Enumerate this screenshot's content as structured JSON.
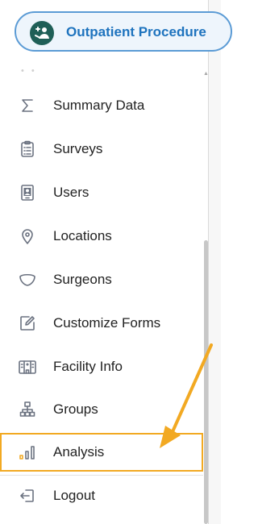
{
  "header": {
    "title": "Outpatient Procedure"
  },
  "menu": {
    "items": [
      {
        "label": "Summary Data",
        "icon": "sigma-icon"
      },
      {
        "label": "Surveys",
        "icon": "clipboard-icon"
      },
      {
        "label": "Users",
        "icon": "user-badge-icon"
      },
      {
        "label": "Locations",
        "icon": "map-pin-icon"
      },
      {
        "label": "Surgeons",
        "icon": "shield-icon"
      },
      {
        "label": "Customize Forms",
        "icon": "edit-form-icon"
      },
      {
        "label": "Facility Info",
        "icon": "building-icon"
      },
      {
        "label": "Groups",
        "icon": "hierarchy-icon"
      },
      {
        "label": "Analysis",
        "icon": "bar-chart-icon",
        "highlighted": true
      },
      {
        "label": "Logout",
        "icon": "logout-icon"
      }
    ]
  },
  "colors": {
    "brand": "#1e73be",
    "highlight": "#f2a922",
    "pill_border": "#5b9bd5",
    "logo_bg": "#1f5f57"
  }
}
